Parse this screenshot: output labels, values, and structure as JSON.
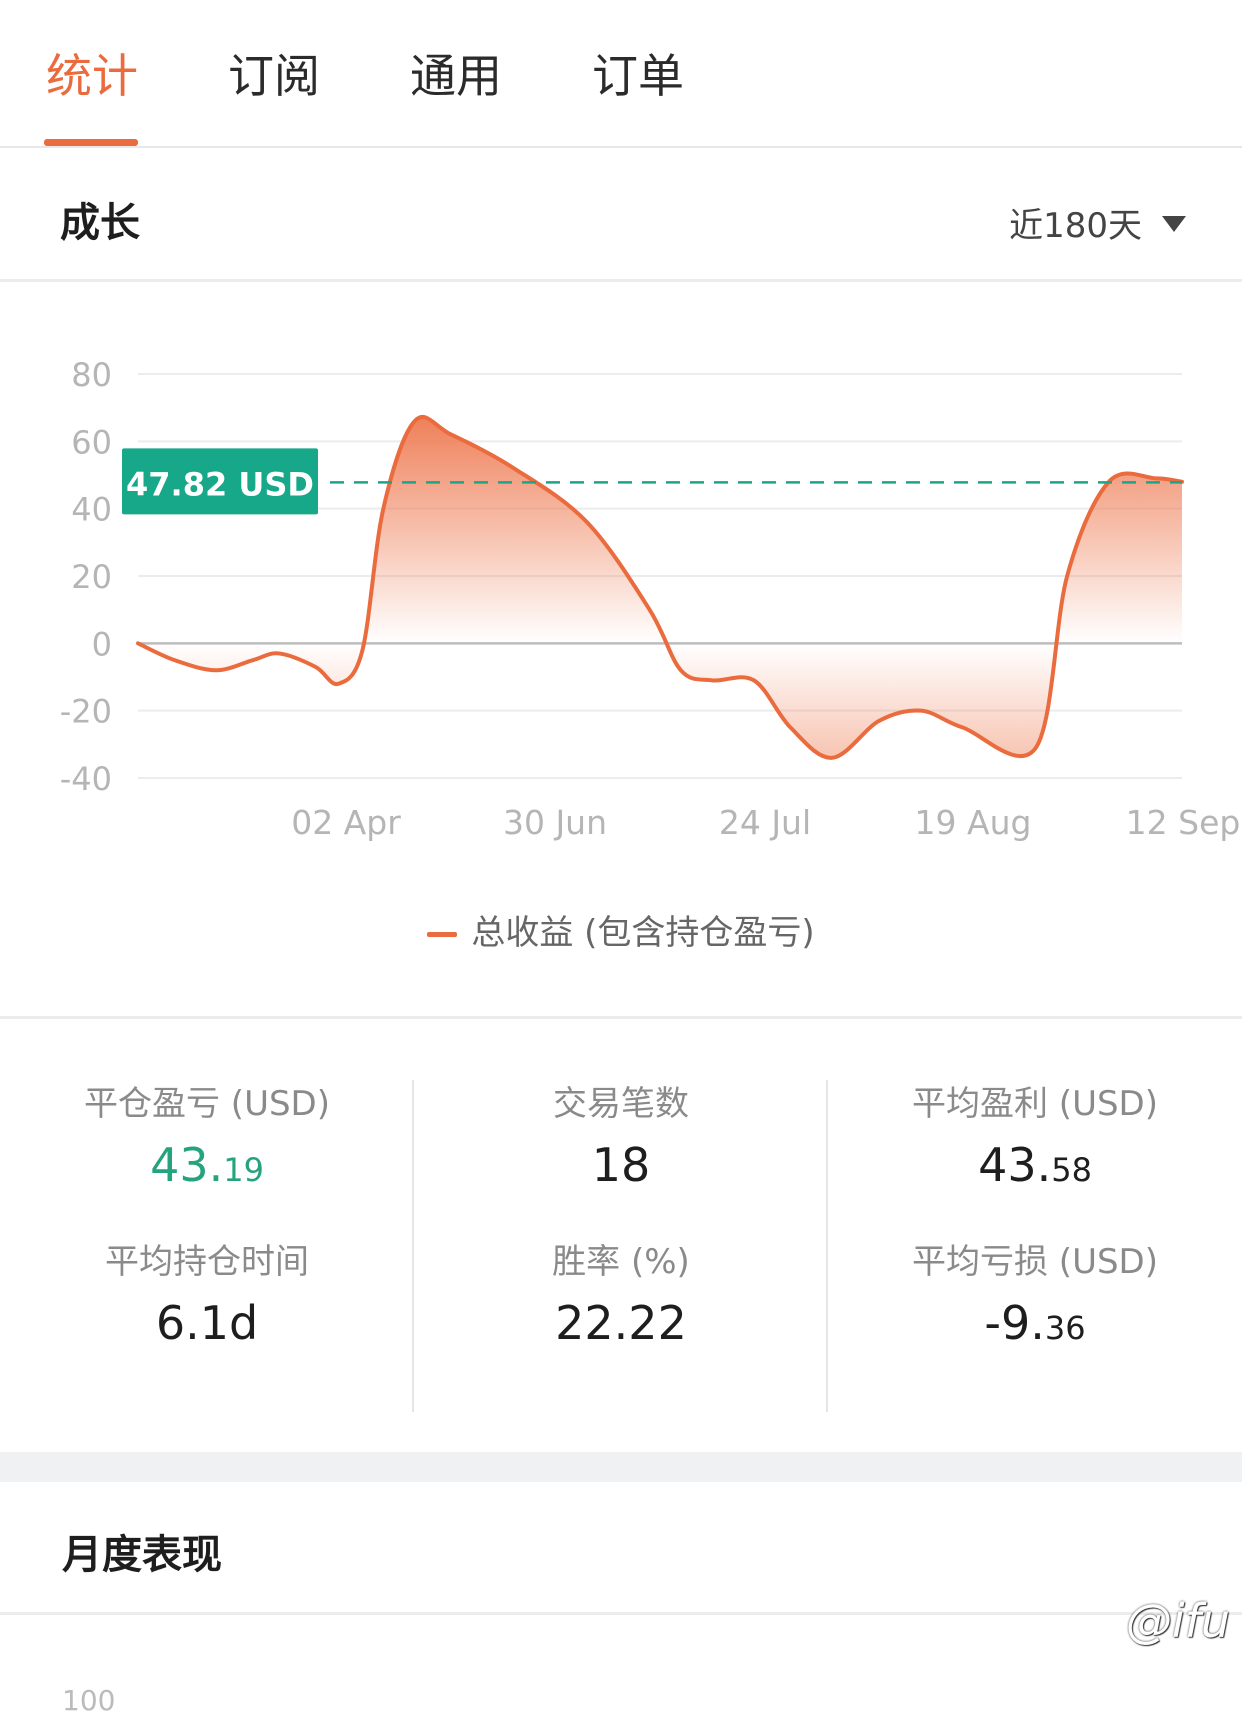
{
  "tabs": [
    {
      "label": "统计",
      "active": true
    },
    {
      "label": "订阅",
      "active": false
    },
    {
      "label": "通用",
      "active": false
    },
    {
      "label": "订单",
      "active": false
    }
  ],
  "growth": {
    "title": "成长",
    "range_label": "近180天",
    "marker_label": "47.82 USD",
    "legend": "总收益 (包含持仓盈亏)"
  },
  "chart_data": {
    "type": "area",
    "x": [
      "02 Apr",
      "30 Jun",
      "24 Jul",
      "19 Aug",
      "12 Sep"
    ],
    "y_ticks": [
      80,
      60,
      40,
      20,
      0,
      -20,
      -40
    ],
    "ylim": [
      -40,
      80
    ],
    "reference_line": 47.82,
    "series": [
      {
        "name": "总收益 (包含持仓盈亏)",
        "points": [
          [
            0.0,
            0
          ],
          [
            0.035,
            -5
          ],
          [
            0.075,
            -8
          ],
          [
            0.11,
            -5
          ],
          [
            0.135,
            -3
          ],
          [
            0.17,
            -7
          ],
          [
            0.192,
            -12
          ],
          [
            0.215,
            -2
          ],
          [
            0.235,
            40
          ],
          [
            0.265,
            66
          ],
          [
            0.3,
            62
          ],
          [
            0.36,
            52
          ],
          [
            0.43,
            36
          ],
          [
            0.49,
            10
          ],
          [
            0.52,
            -8
          ],
          [
            0.55,
            -11
          ],
          [
            0.59,
            -11
          ],
          [
            0.625,
            -25
          ],
          [
            0.665,
            -34
          ],
          [
            0.71,
            -23
          ],
          [
            0.75,
            -20
          ],
          [
            0.79,
            -25
          ],
          [
            0.86,
            -31
          ],
          [
            0.89,
            20
          ],
          [
            0.93,
            48
          ],
          [
            0.975,
            49
          ],
          [
            1.0,
            48
          ]
        ],
        "color": "#ea6b3d"
      }
    ],
    "grid": true
  },
  "stats": {
    "closed_pnl": {
      "label": "平仓盈亏 (USD)",
      "int": "43.",
      "dec": "19"
    },
    "trade_count": {
      "label": "交易笔数",
      "value": "18"
    },
    "avg_profit": {
      "label": "平均盈利 (USD)",
      "int": "43.",
      "dec": "58"
    },
    "avg_hold": {
      "label": "平均持仓时间",
      "value": "6.1d"
    },
    "win_rate": {
      "label": "胜率 (%)",
      "value": "22.22"
    },
    "avg_loss": {
      "label": "平均亏损 (USD)",
      "int": "-9.",
      "dec": "36"
    }
  },
  "monthly": {
    "title": "月度表现",
    "first_tick": "100"
  },
  "watermark": "@ifu"
}
